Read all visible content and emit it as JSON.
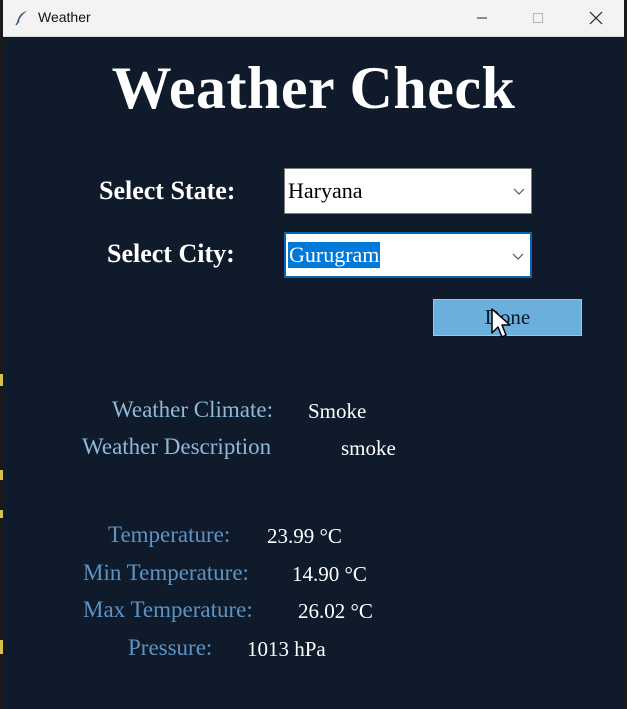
{
  "window": {
    "title": "Weather",
    "controls": [
      "minimize-icon",
      "maximize-icon",
      "close-icon"
    ],
    "background": "#0f1b2b"
  },
  "heading": "Weather Check",
  "form": {
    "state_label": "Select State:",
    "state_value": "Haryana",
    "city_label": "Select City:",
    "city_value": "Gurugram",
    "done_label": "Done"
  },
  "info": {
    "climate_label": "Weather Climate:",
    "climate_value": "Smoke",
    "description_label": "Weather Description",
    "description_value": "smoke",
    "temperature_label": "Temperature:",
    "temperature_value": "23.99 °C",
    "min_label": "Min Temperature:",
    "min_value": "14.90 °C",
    "max_label": "Max Temperature:",
    "max_value": "26.02 °C",
    "pressure_label": "Pressure:",
    "pressure_value": "1013 hPa"
  },
  "colors": {
    "accent_button": "#6bb0dc",
    "selection": "#0078d7",
    "label_text": "#8fb9da"
  }
}
